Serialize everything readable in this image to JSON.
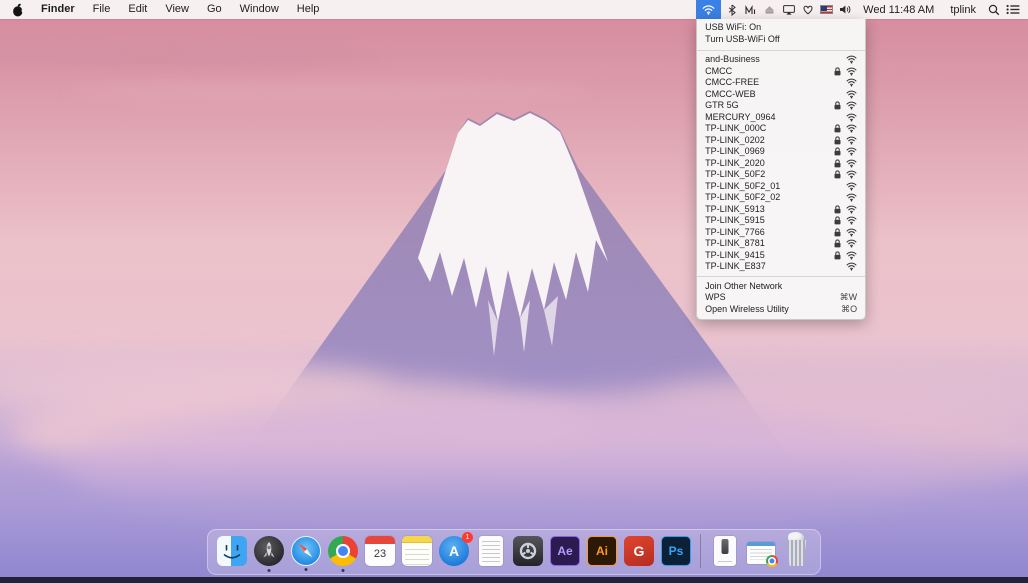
{
  "menu_bar": {
    "menus": [
      "Finder",
      "File",
      "Edit",
      "View",
      "Go",
      "Window",
      "Help"
    ],
    "status": {
      "clock": "Wed 11:48 AM",
      "user": "tplink"
    }
  },
  "wifi_menu": {
    "header_items": [
      "USB WiFi: On",
      "Turn USB-WiFi Off"
    ],
    "networks": [
      {
        "name": "and-Business",
        "locked": false
      },
      {
        "name": "CMCC",
        "locked": true
      },
      {
        "name": "CMCC-FREE",
        "locked": false
      },
      {
        "name": "CMCC-WEB",
        "locked": false
      },
      {
        "name": "GTR 5G",
        "locked": true
      },
      {
        "name": "MERCURY_0964",
        "locked": false
      },
      {
        "name": "TP-LINK_000C",
        "locked": true
      },
      {
        "name": "TP-LINK_0202",
        "locked": true
      },
      {
        "name": "TP-LINK_0969",
        "locked": true
      },
      {
        "name": "TP-LINK_2020",
        "locked": true
      },
      {
        "name": "TP-LINK_50F2",
        "locked": true
      },
      {
        "name": "TP-LINK_50F2_01",
        "locked": false
      },
      {
        "name": "TP-LINK_50F2_02",
        "locked": false
      },
      {
        "name": "TP-LINK_5913",
        "locked": true
      },
      {
        "name": "TP-LINK_5915",
        "locked": true
      },
      {
        "name": "TP-LINK_7766",
        "locked": true
      },
      {
        "name": "TP-LINK_8781",
        "locked": true
      },
      {
        "name": "TP-LINK_9415",
        "locked": true
      },
      {
        "name": "TP-LINK_E837",
        "locked": false
      }
    ],
    "actions": [
      {
        "label": "Join Other Network",
        "shortcut": ""
      },
      {
        "label": "WPS",
        "shortcut": "⌘W"
      },
      {
        "label": "Open Wireless Utility",
        "shortcut": "⌘O"
      }
    ]
  },
  "dock": {
    "calendar_day": "23",
    "app_store_badge": "1",
    "labels": {
      "after_effects": "Ae",
      "illustrator": "Ai",
      "g_app": "G",
      "photoshop": "Ps"
    }
  },
  "colors": {
    "menubar_highlight": "#3b80e4",
    "sky_top": "#d4899c",
    "sky_bottom": "#8e85cf",
    "dock_dot": "#2a2842"
  }
}
